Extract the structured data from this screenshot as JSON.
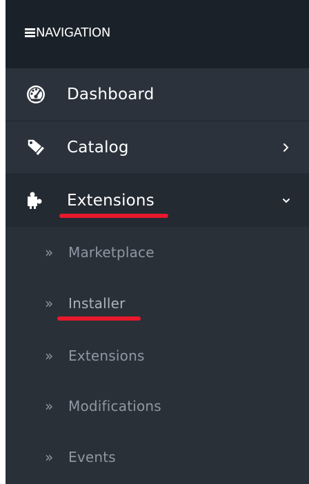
{
  "nav": {
    "header": {
      "title": "NAVIGATION",
      "icon": "hamburger-icon"
    },
    "items": [
      {
        "label": "Dashboard",
        "icon": "dashboard-icon"
      },
      {
        "label": "Catalog",
        "icon": "tags-icon",
        "chevron": "›"
      },
      {
        "label": "Extensions",
        "icon": "puzzle-icon",
        "chevron": "⌄",
        "expanded": true
      }
    ],
    "sub_items": [
      {
        "label": "Marketplace",
        "prefix": "»"
      },
      {
        "label": "Installer",
        "prefix": "»"
      },
      {
        "label": "Extensions",
        "prefix": "»"
      },
      {
        "label": "Modifications",
        "prefix": "»"
      },
      {
        "label": "Events",
        "prefix": "»"
      }
    ]
  },
  "colors": {
    "header_bg": "#1b2128",
    "sidebar_bg": "#2b323c",
    "active_bg": "#242a32",
    "submenu_text": "#8e98a3",
    "annotation_red": "#e8192c"
  }
}
